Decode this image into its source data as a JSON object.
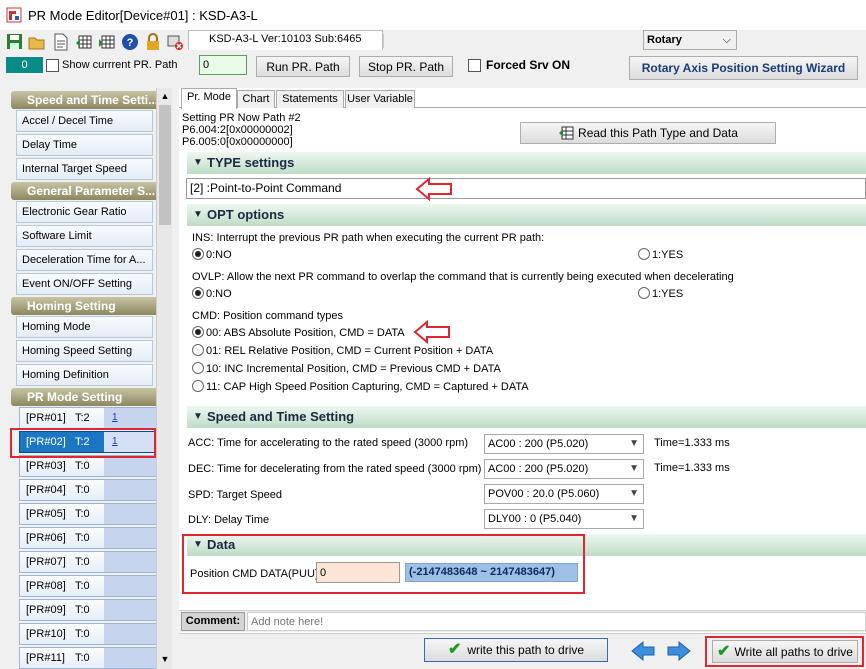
{
  "window": {
    "title": "PR Mode Editor[Device#01]  : KSD-A3-L"
  },
  "toolbar": {
    "icons": [
      "save-icon",
      "open-folder-icon",
      "document-icon",
      "table-read-icon",
      "table-write-icon",
      "help-icon",
      "lock-icon",
      "disconnect-icon"
    ],
    "device_tab": "KSD-A3-L Ver:10103 Sub:6465",
    "rotary_select": "Rotary"
  },
  "control_bar": {
    "counter": "0",
    "show_current_label": "Show currrent PR. Path",
    "path_input": "0",
    "run_button": "Run PR. Path",
    "stop_button": "Stop PR. Path",
    "forced_srv_label": "Forced Srv ON",
    "wizard_button": "Rotary Axis Position Setting Wizard"
  },
  "sidebar": {
    "groups": [
      {
        "title": "Speed and Time Setti...",
        "items": [
          "Accel / Decel Time",
          "Delay Time",
          "Internal Target Speed"
        ]
      },
      {
        "title": "General Parameter S...",
        "items": [
          "Electronic Gear Ratio",
          "Software Limit",
          "Deceleration Time for A...",
          "Event ON/OFF Setting"
        ]
      },
      {
        "title": "Homing Setting",
        "items": [
          "Homing Mode",
          "Homing Speed Setting",
          "Homing Definition"
        ]
      },
      {
        "title": "PR Mode Setting",
        "items": []
      }
    ],
    "pr_paths": [
      {
        "label": "[PR#01]",
        "t": "T:2",
        "mark": "1"
      },
      {
        "label": "[PR#02]",
        "t": "T:2",
        "mark": "1"
      },
      {
        "label": "[PR#03]",
        "t": "T:0",
        "mark": ""
      },
      {
        "label": "[PR#04]",
        "t": "T:0",
        "mark": ""
      },
      {
        "label": "[PR#05]",
        "t": "T:0",
        "mark": ""
      },
      {
        "label": "[PR#06]",
        "t": "T:0",
        "mark": ""
      },
      {
        "label": "[PR#07]",
        "t": "T:0",
        "mark": ""
      },
      {
        "label": "[PR#08]",
        "t": "T:0",
        "mark": ""
      },
      {
        "label": "[PR#09]",
        "t": "T:0",
        "mark": ""
      },
      {
        "label": "[PR#10]",
        "t": "T:0",
        "mark": ""
      },
      {
        "label": "[PR#11]",
        "t": "T:0",
        "mark": ""
      }
    ],
    "selected_index": 1
  },
  "tabs": [
    "Pr. Mode",
    "Chart",
    "Statements",
    "User Variable"
  ],
  "info": {
    "line1": "Setting PR Now Path #2",
    "line2": "P6.004:2[0x00000002]",
    "line3": "P6.005:0[0x00000000]",
    "read_button": "Read this Path Type and Data"
  },
  "type_section": {
    "title": "TYPE settings",
    "value": "[2] :Point-to-Point Command"
  },
  "opt_section": {
    "title": "OPT options",
    "ins_label": "INS: Interrupt the previous PR path when executing the current PR path:",
    "ins_no": "0:NO",
    "ins_yes": "1:YES",
    "ovlp_label": "OVLP: Allow the next PR command to overlap the command that is currently being executed when decelerating",
    "ovlp_no": "0:NO",
    "ovlp_yes": "1:YES",
    "cmd_label": "CMD: Position command types",
    "cmd_options": [
      "00: ABS Absolute Position, CMD = DATA",
      "01: REL Relative Position, CMD = Current Position + DATA",
      "10: INC Incremental Position, CMD = Previous CMD + DATA",
      "11: CAP High Speed Position Capturing, CMD = Captured + DATA"
    ],
    "cmd_selected": 0
  },
  "speed_section": {
    "title": "Speed and Time Setting",
    "acc_label": "ACC: Time for accelerating to the rated speed (3000 rpm)",
    "acc_value": "AC00 : 200 (P5.020)",
    "acc_time": "Time=1.333 ms",
    "dec_label": "DEC: Time for decelerating from the rated speed (3000 rpm)",
    "dec_value": "AC00 : 200 (P5.020)",
    "dec_time": "Time=1.333 ms",
    "spd_label": "SPD: Target Speed",
    "spd_value": "POV00 : 20.0 (P5.060)",
    "dly_label": "DLY: Delay Time",
    "dly_value": "DLY00 : 0 (P5.040)"
  },
  "data_section": {
    "title": "Data",
    "pos_label": "Position CMD DATA(PUU)",
    "pos_value": "0",
    "range": "(-2147483648 ~ 2147483647)"
  },
  "comment": {
    "label": "Comment:",
    "placeholder": "Add note here!"
  },
  "bottom": {
    "write_path": "write this path to drive",
    "write_all": "Write all paths to drive"
  },
  "colors": {
    "highlight_red": "#e0262e",
    "selected_blue": "#1b77c4",
    "section_green": "#bfdcc6"
  }
}
